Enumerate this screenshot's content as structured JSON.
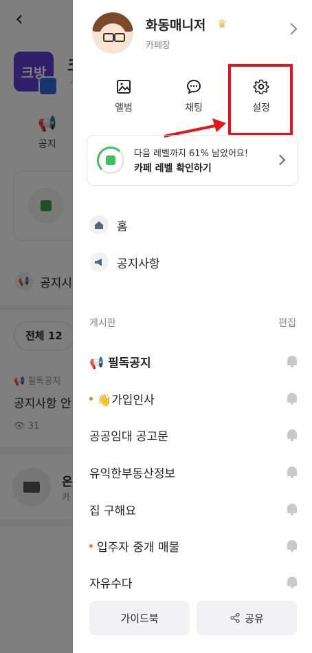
{
  "background": {
    "cafe_logo_text": "크방",
    "cafe_name_partial": "크",
    "cafe_sub_partial": "ㅅ",
    "notice_tab_label": "공지",
    "section_title": "공지시",
    "filter_chip": "전체 12",
    "post_category": "필독공지",
    "post_title": "공지사항 안",
    "post_views": "31",
    "mail_title": "온",
    "mail_sub": "카"
  },
  "drawer": {
    "profile": {
      "nickname": "화동매니저",
      "role": "카페장"
    },
    "shortcuts": [
      {
        "label": "앨범",
        "icon": "image-icon"
      },
      {
        "label": "채팅",
        "icon": "chat-bubble-icon"
      },
      {
        "label": "설정",
        "icon": "gear-icon"
      }
    ],
    "level": {
      "line1": "다음 레벨까지 61% 남았어요!",
      "line2": "카페 레벨 확인하기",
      "progress_percent": 39
    },
    "menu": [
      {
        "label": "홈",
        "icon": "home-icon"
      },
      {
        "label": "공지사항",
        "icon": "megaphone-icon"
      }
    ],
    "board_header": {
      "title": "게시판",
      "edit": "편집"
    },
    "boards": [
      {
        "label": "📢 필독공지",
        "new": false
      },
      {
        "label": "👋가입인사",
        "new": true
      },
      {
        "label": "공공임대 공고문",
        "new": false
      },
      {
        "label": "유익한부동산정보",
        "new": false
      },
      {
        "label": "집 구해요",
        "new": false
      },
      {
        "label": "입주자 중개 매물",
        "new": true
      },
      {
        "label": "자유수다",
        "new": false
      }
    ],
    "bottom": {
      "guide": "가이드북",
      "share": "공유"
    }
  },
  "colors": {
    "highlight": "#e3141c",
    "level_green": "#3fbf62",
    "new_dot": "#f07a1f"
  }
}
